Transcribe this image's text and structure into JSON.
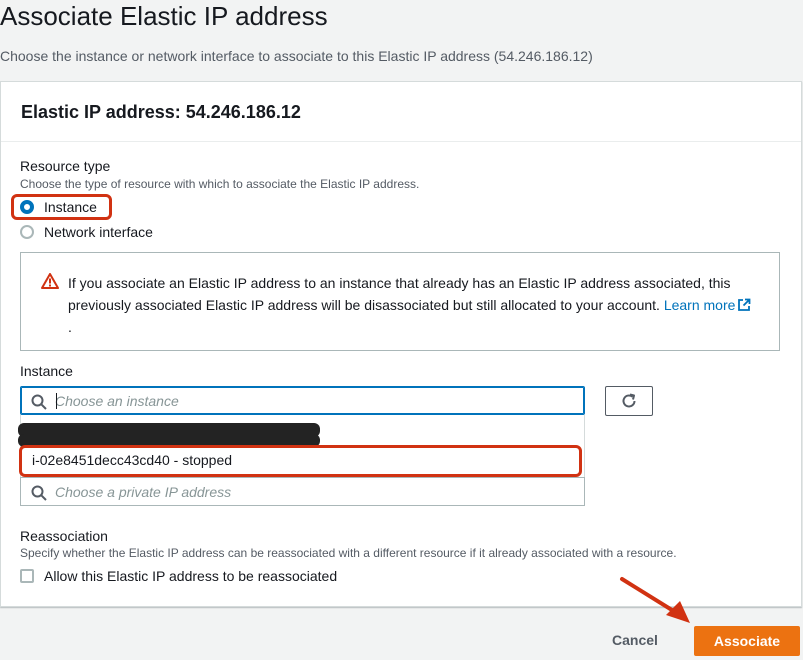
{
  "page": {
    "title": "Associate Elastic IP address",
    "description": "Choose the instance or network interface to associate to this Elastic IP address (54.246.186.12)"
  },
  "panel": {
    "title": "Elastic IP address: 54.246.186.12"
  },
  "resource_type": {
    "label": "Resource type",
    "hint": "Choose the type of resource with which to associate the Elastic IP address.",
    "options": [
      {
        "label": "Instance",
        "selected": true
      },
      {
        "label": "Network interface",
        "selected": false
      }
    ]
  },
  "alert": {
    "icon": "warning-icon",
    "text": "If you associate an Elastic IP address to an instance that already has an Elastic IP address associated, this previously associated Elastic IP address will be disassociated but still allocated to your account.",
    "link": "Learn more",
    "trailing": "."
  },
  "instance": {
    "label": "Instance",
    "placeholder": "Choose an instance",
    "selected_option": "i-02e8451decc43cd40 - stopped",
    "refresh_icon": "refresh-icon"
  },
  "private_ip": {
    "placeholder": "Choose a private IP address"
  },
  "reassociation": {
    "label": "Reassociation",
    "hint": "Specify whether the Elastic IP address can be reassociated with a different resource if it already associated with a resource.",
    "checkbox_label": "Allow this Elastic IP address to be reassociated",
    "checked": false
  },
  "footer": {
    "cancel_label": "Cancel",
    "associate_label": "Associate"
  },
  "colors": {
    "primary": "#ec7211",
    "link": "#0073bb",
    "annotation": "#d13212"
  }
}
